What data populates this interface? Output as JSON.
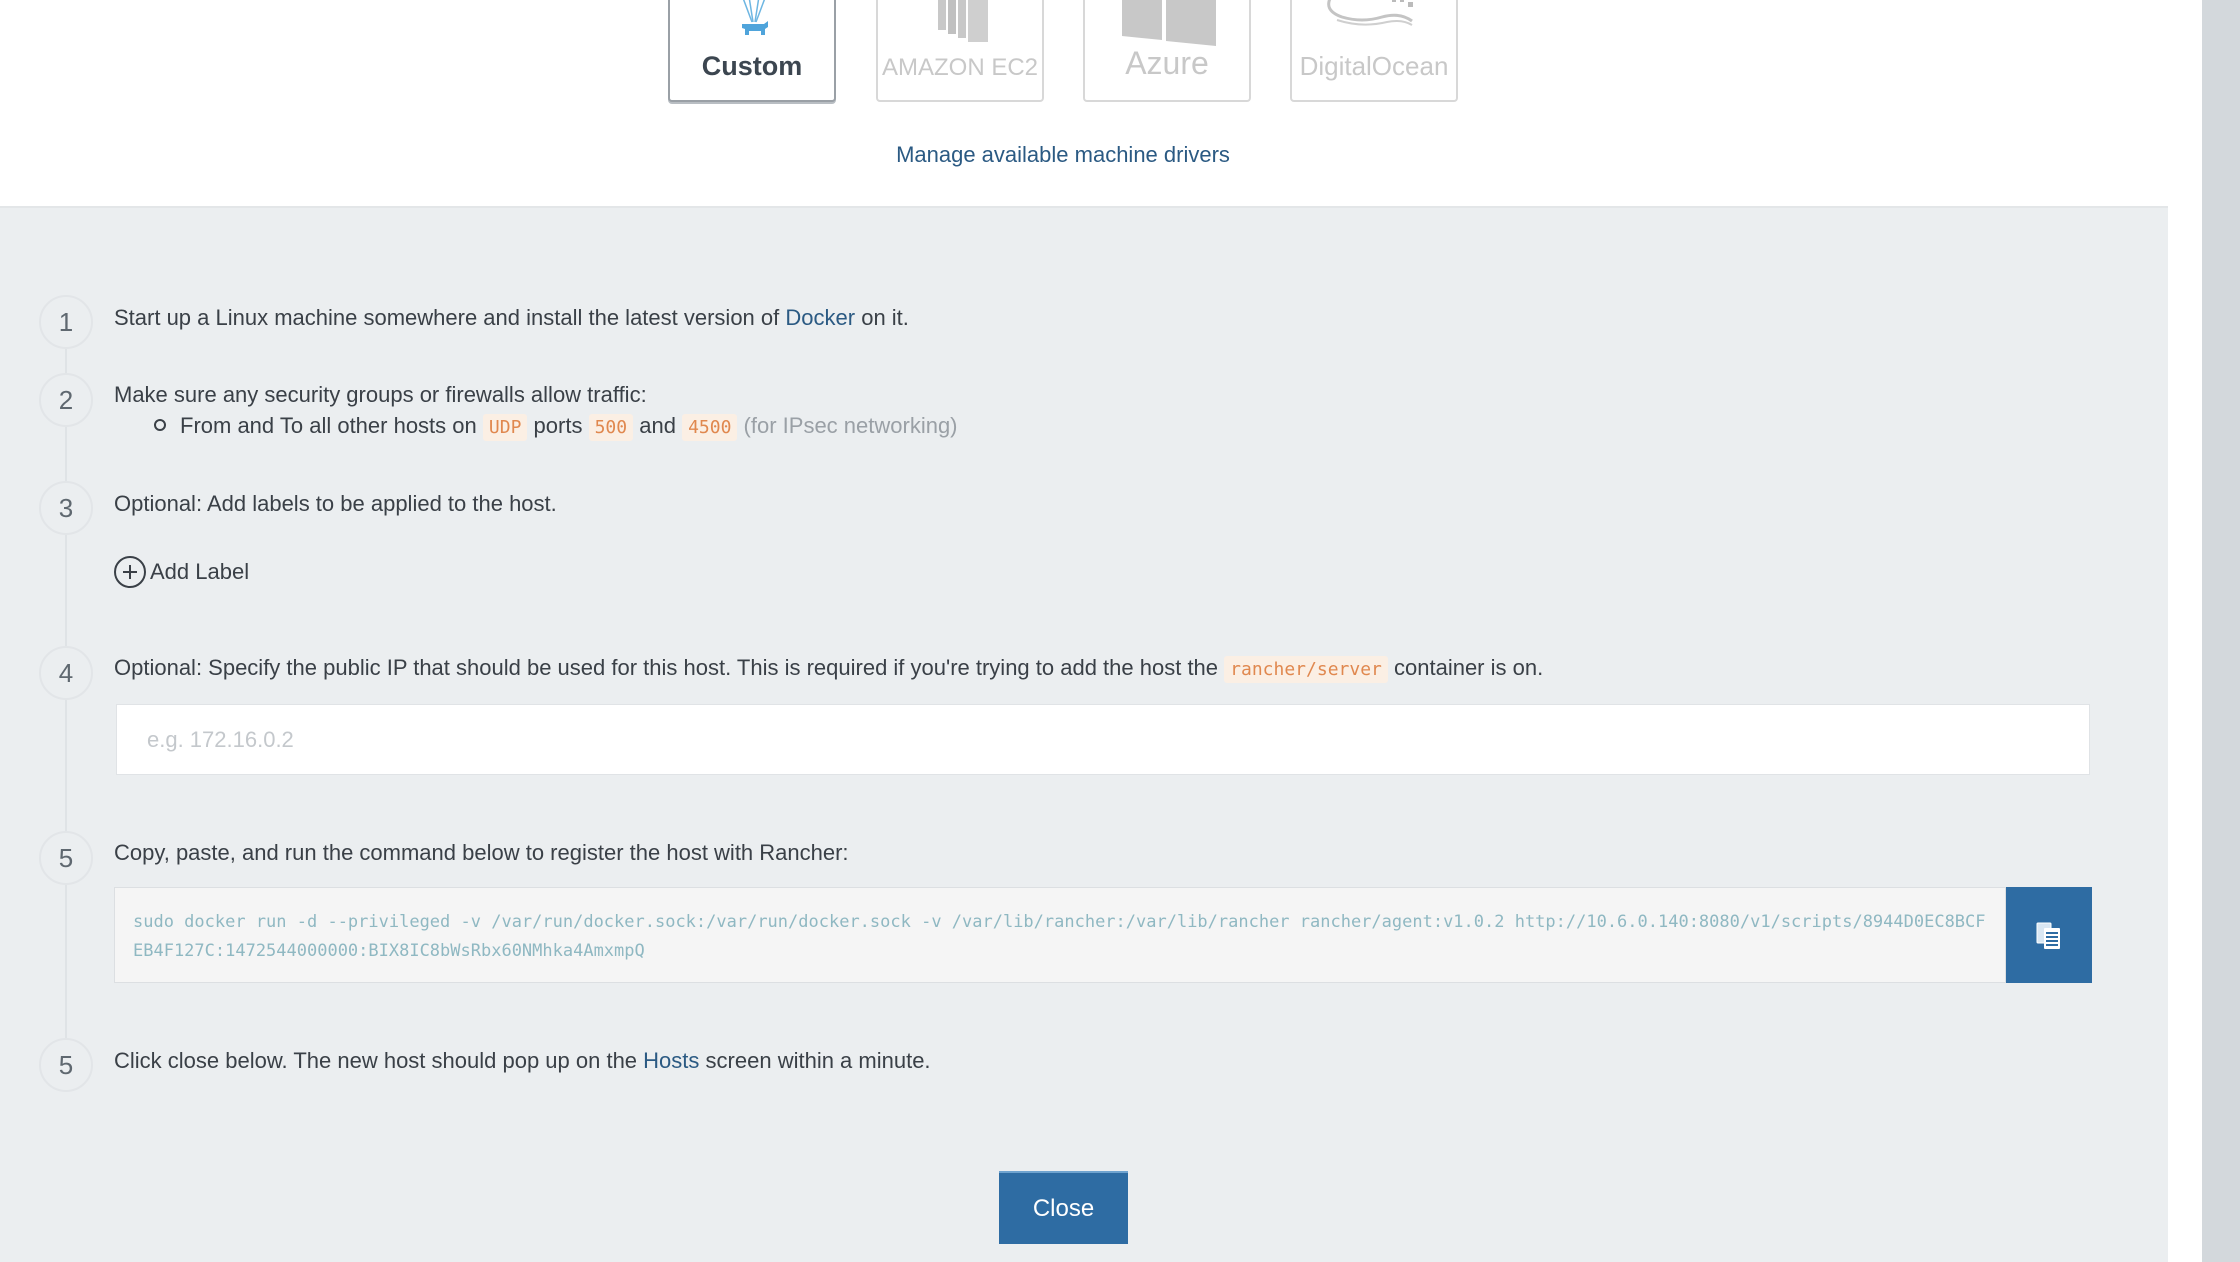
{
  "drivers": [
    {
      "id": "custom",
      "label": "Custom",
      "selected": true
    },
    {
      "id": "amazonec2",
      "label": "AMAZON EC2",
      "selected": false
    },
    {
      "id": "azure",
      "label": "Azure",
      "selected": false
    },
    {
      "id": "digitalocean",
      "label": "DigitalOcean",
      "selected": false
    }
  ],
  "manage_drivers_link": "Manage available machine drivers",
  "steps": {
    "step1": {
      "number": "1",
      "text_before": "Start up a Linux machine somewhere and install the latest version of",
      "link": "Docker",
      "text_after": "on it."
    },
    "step2": {
      "number": "2",
      "text": "Make sure any security groups or firewalls allow traffic:",
      "bullet": {
        "text_a": "From and To all other hosts on",
        "protocol": "UDP",
        "text_b": "ports",
        "port1": "500",
        "text_c": "and",
        "port2": "4500",
        "note": "(for IPsec networking)"
      }
    },
    "step3": {
      "number": "3",
      "text": "Optional: Add labels to be applied to the host.",
      "add_label": "Add Label"
    },
    "step4": {
      "number": "4",
      "text_before": "Optional: Specify the public IP that should be used for this host. This is required if you're trying to add the host the",
      "code": "rancher/server",
      "text_after": "container is on.",
      "ip_placeholder": "e.g. 172.16.0.2",
      "ip_value": ""
    },
    "step5": {
      "number": "5",
      "text": "Copy, paste, and run the command below to register the host with Rancher:",
      "command": "sudo docker run -d --privileged -v /var/run/docker.sock:/var/run/docker.sock -v /var/lib/rancher:/var/lib/rancher rancher/agent:v1.0.2 http://10.6.0.140:8080/v1/scripts/8944D0EC8BCFEB4F127C:1472544000000:BIX8IC8bWsRbx60NMhka4AmxmpQ"
    },
    "step6": {
      "number": "5",
      "text_before": "Click close below. The new host should pop up on the",
      "link": "Hosts",
      "text_after": "screen within a minute."
    }
  },
  "close_button": "Close",
  "colors": {
    "accent": "#2e6ca3",
    "link": "#2b5a83",
    "code_text": "#e0884f",
    "code_bg": "#fbefe4",
    "section_bg": "#ebeef0"
  }
}
